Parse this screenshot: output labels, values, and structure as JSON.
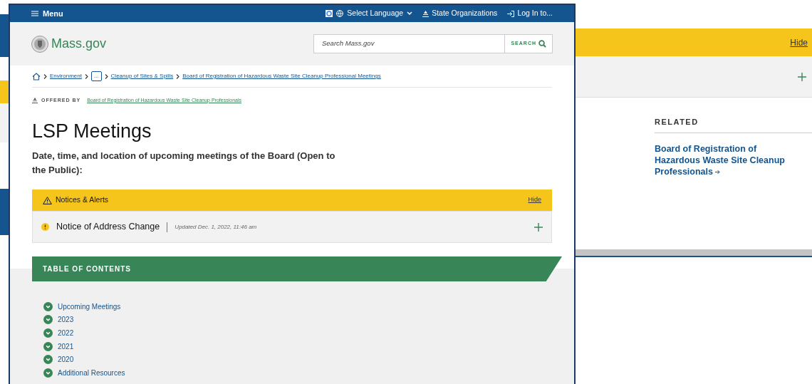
{
  "background_page": {
    "alert_hide": "Hide",
    "related": {
      "heading": "RELATED",
      "link": "Board of Registration of Hazardous Waste Site Cleanup Professionals"
    }
  },
  "front_page": {
    "topbar": {
      "menu": "Menu",
      "language": "Select Language",
      "state_orgs": "State Organizations",
      "login": "Log In to..."
    },
    "logo": "Mass.gov",
    "search": {
      "placeholder": "Search Mass.gov",
      "button": "SEARCH"
    },
    "breadcrumbs": [
      {
        "label": "Environment",
        "kind": "link"
      },
      {
        "label": "...",
        "kind": "collapsed"
      },
      {
        "label": "Cleanup of Sites & Spills",
        "kind": "link"
      },
      {
        "label": "Board of Registration of Hazardous Waste Site Cleanup Professional Meetings",
        "kind": "link"
      }
    ],
    "offered_by": {
      "label": "OFFERED BY",
      "link": "Board of Registration of Hazardous Waste Site Cleanup Professionals"
    },
    "title": "LSP Meetings",
    "description": "Date, time, and location of upcoming meetings of the Board (Open to the Public):",
    "alerts": {
      "title": "Notices & Alerts",
      "hide": "Hide",
      "items": [
        {
          "title": "Notice of Address Change",
          "updated": "Updated Dec. 1, 2022, 11:46 am"
        }
      ]
    },
    "toc": {
      "title": "TABLE OF CONTENTS",
      "items": [
        "Upcoming Meetings",
        "2023",
        "2022",
        "2021",
        "2020",
        "Additional Resources"
      ]
    }
  }
}
